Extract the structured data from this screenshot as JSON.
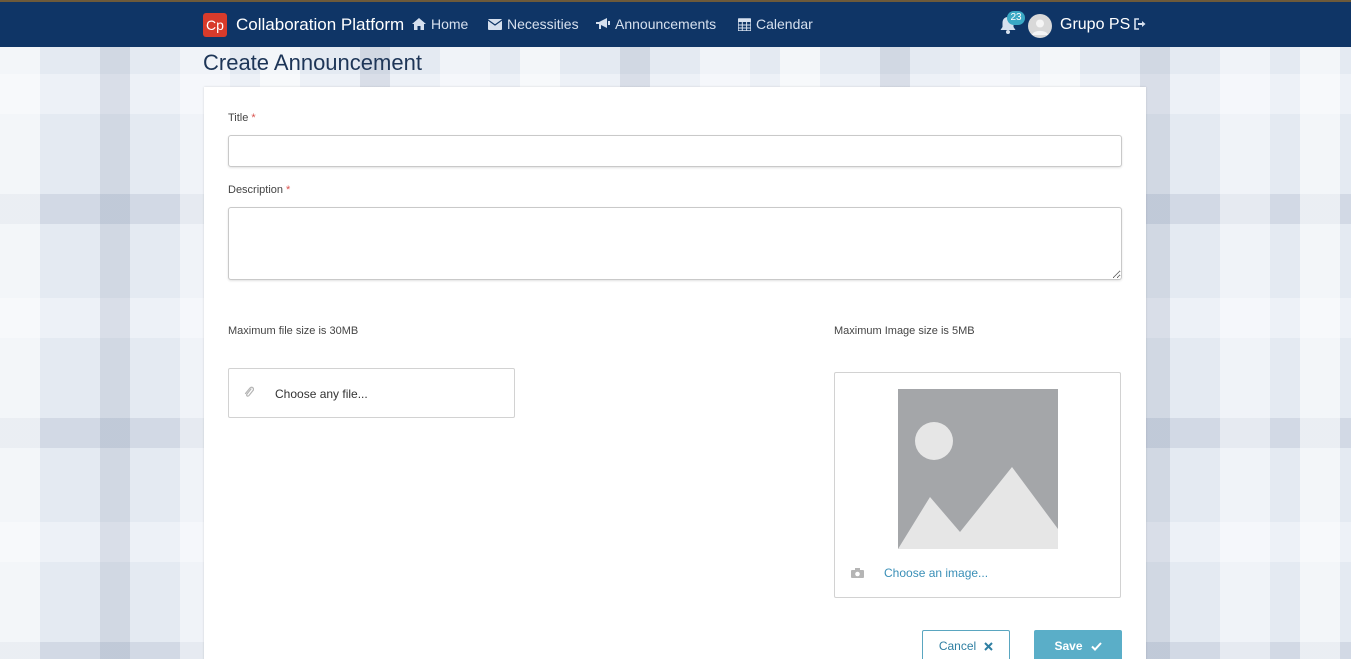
{
  "navbar": {
    "logo_text": "Cp",
    "brand": "Collaboration Platform",
    "items": [
      {
        "label": "Home",
        "icon": "home-icon"
      },
      {
        "label": "Necessities",
        "icon": "envelope-icon"
      },
      {
        "label": "Announcements",
        "icon": "bullhorn-icon"
      },
      {
        "label": "Calendar",
        "icon": "calendar-icon"
      }
    ],
    "notification_count": "23",
    "user_name": "Grupo PS",
    "colors": {
      "background": "#0f3566",
      "logo": "#d83b2b",
      "badge": "#3aa8c4"
    }
  },
  "page": {
    "title": "Create Announcement"
  },
  "form": {
    "title_label": "Title",
    "description_label": "Description",
    "required_mark": "*",
    "title_value": "",
    "description_value": "",
    "file_hint": "Maximum file size is 30MB",
    "image_hint": "Maximum Image size is 5MB",
    "file_placeholder": "Choose any file...",
    "image_link": "Choose an image...",
    "cancel_label": "Cancel",
    "save_label": "Save",
    "colors": {
      "accent": "#5aaec8",
      "required": "#d9534f",
      "link": "#3a8fb7"
    }
  }
}
